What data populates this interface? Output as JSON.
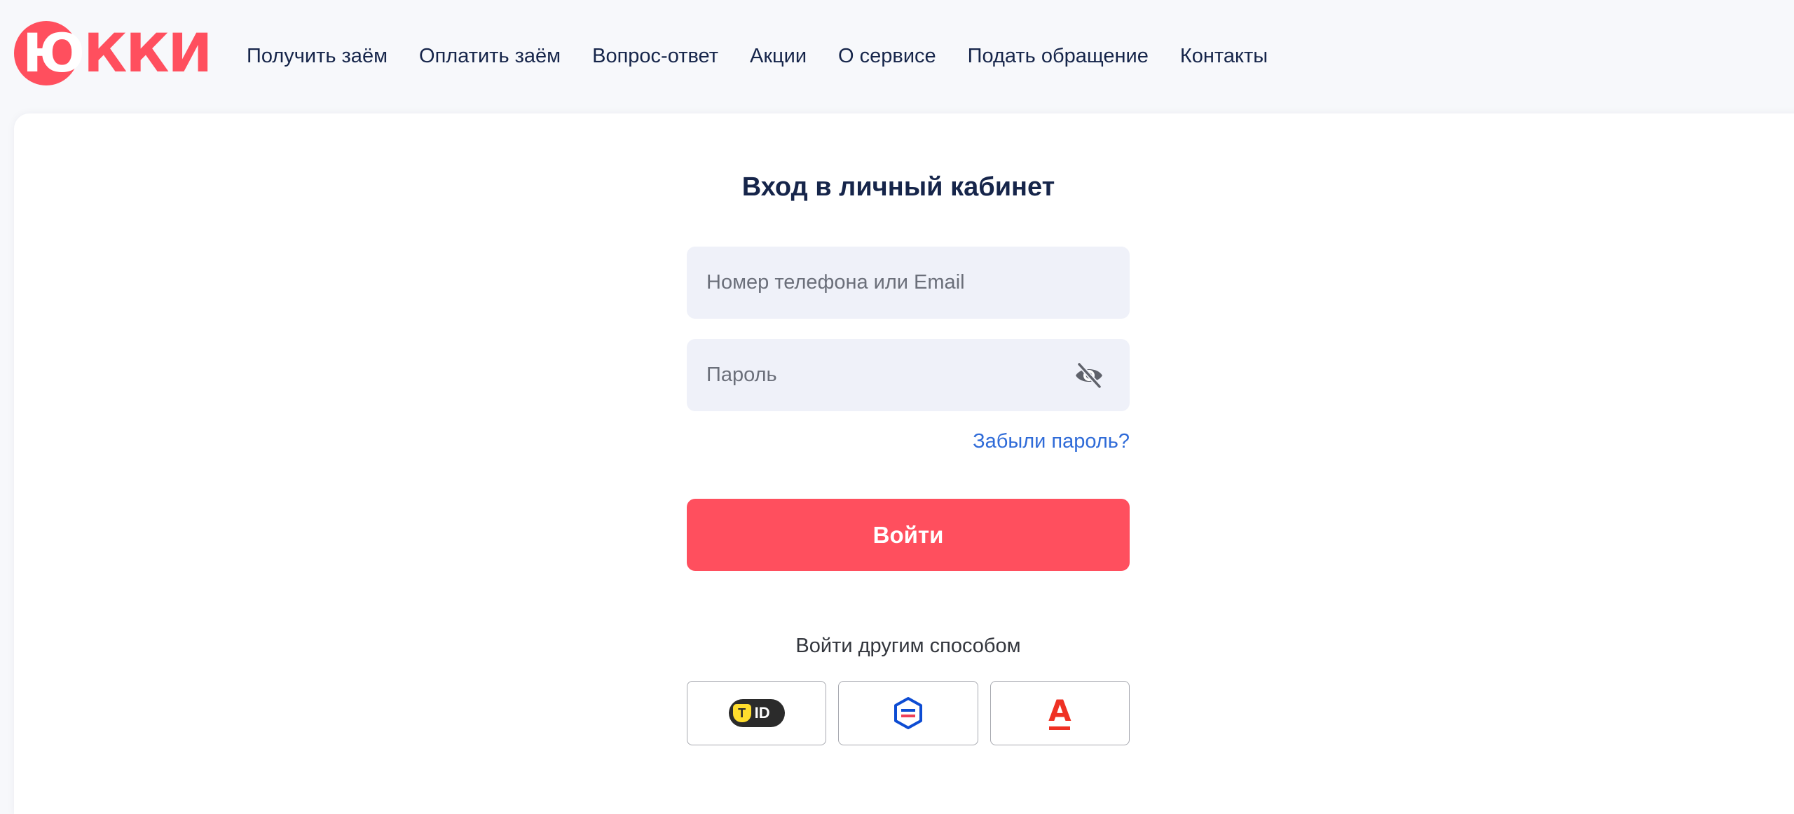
{
  "brand": {
    "logo_first_letter": "Ю",
    "logo_rest": "кки",
    "color": "#ff4f5e"
  },
  "nav": {
    "items": [
      {
        "label": "Получить заём"
      },
      {
        "label": "Оплатить заём"
      },
      {
        "label": "Вопрос-ответ"
      },
      {
        "label": "Акции"
      },
      {
        "label": "О сервисе"
      },
      {
        "label": "Подать обращение"
      },
      {
        "label": "Контакты"
      }
    ]
  },
  "login_form": {
    "title": "Вход в личный кабинет",
    "login_placeholder": "Номер телефона или Email",
    "login_value": "",
    "password_placeholder": "Пароль",
    "password_value": "",
    "password_toggle_icon": "eye-off-icon",
    "forgot_label": "Забыли пароль?",
    "submit_label": "Войти",
    "submit_color": "#ff4f5e",
    "link_color": "#2f6bd8"
  },
  "alt_login": {
    "label": "Войти другим способом",
    "methods": [
      {
        "icon": "tbank-id-icon",
        "badge_letter": "T",
        "badge_text": "ID"
      },
      {
        "icon": "gosuslugi-icon"
      },
      {
        "icon": "alfa-bank-icon",
        "letter": "А"
      }
    ]
  }
}
